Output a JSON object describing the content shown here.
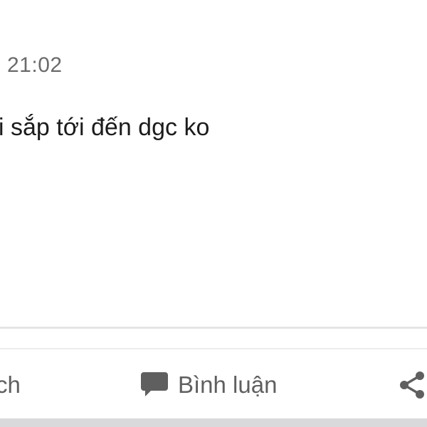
{
  "post": {
    "timestamp": "21:02",
    "text": "i sắp tới đến dgc ko"
  },
  "actions": {
    "like_label_partial": "ch",
    "comment_label": "Bình luận",
    "comment_icon": "speech-bubble-icon",
    "share_icon": "share-icon"
  },
  "colors": {
    "timestamp": "#6b6b6b",
    "text": "#1c1c1c",
    "action": "#5f5f5f",
    "divider": "#e4e4e6"
  }
}
